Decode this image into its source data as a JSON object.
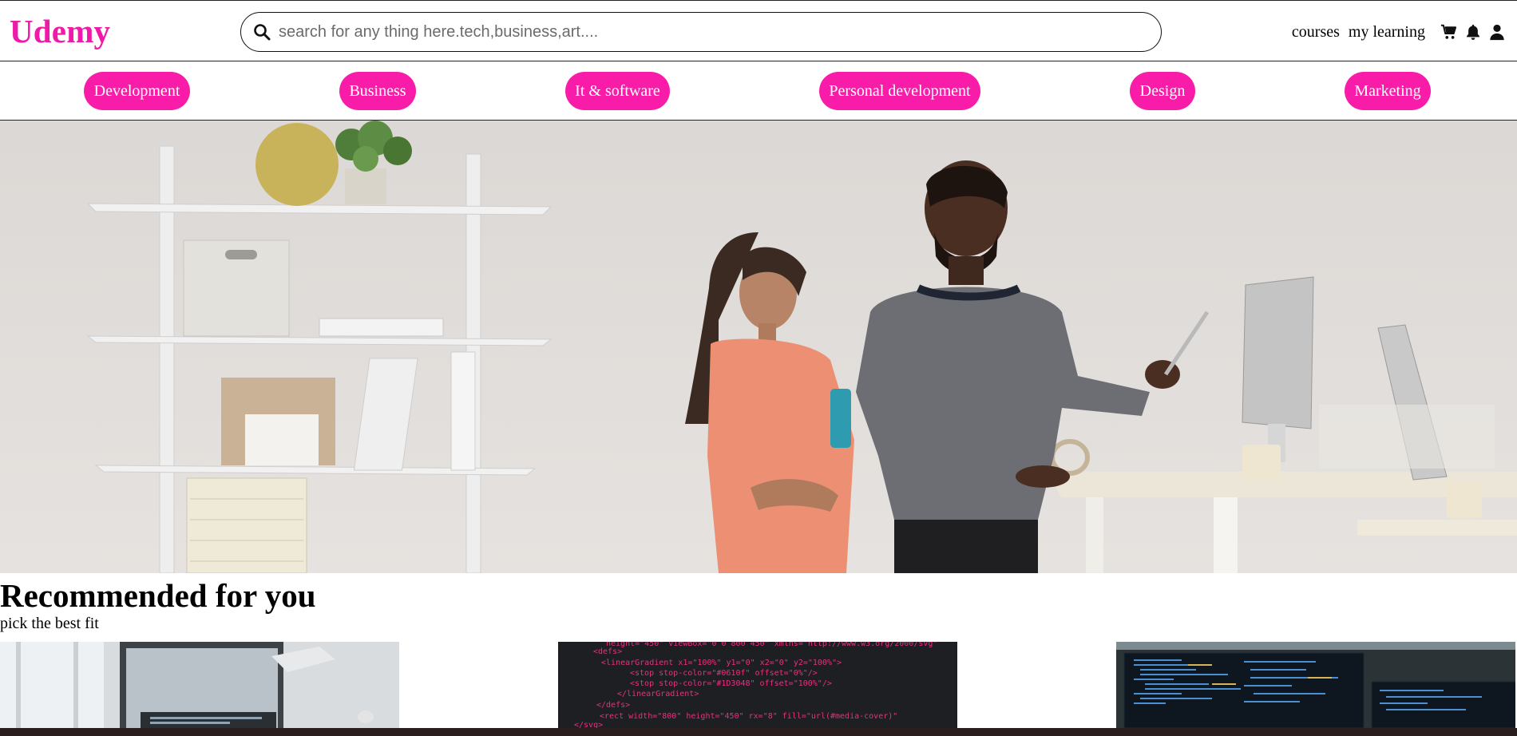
{
  "brand": {
    "name": "Udemy",
    "color": "#f01aa8"
  },
  "search": {
    "placeholder": "search for any thing here.tech,business,art...."
  },
  "nav": {
    "courses_label": "courses",
    "my_learning_label": "my learning",
    "icons": [
      "cart-icon",
      "bell-icon",
      "user-icon"
    ]
  },
  "categories": [
    {
      "label": "Development"
    },
    {
      "label": "Business"
    },
    {
      "label": "It & software"
    },
    {
      "label": "Personal development"
    },
    {
      "label": "Design"
    },
    {
      "label": "Marketing"
    }
  ],
  "accent_color": "#f81ca9",
  "recommended": {
    "title": "Recommended for you",
    "subtitle": "pick the best fit"
  },
  "code_card": {
    "lines": [
      "<defs>",
      "  <linearGradient x1=\"100%\" y1=\"0\" x2=\"0\" y2=\"100%\">",
      "    <stop stop-color=\"#0610f\" offset=\"0%\"/>",
      "    <stop stop-color=\"#1D3048\" offset=\"100%\"/>",
      "  </linearGradient>",
      "</defs>",
      "<rect width=\"800\" height=\"450\" rx=\"8\" fill=\"url(#media-cover)\"",
      "</svg>"
    ]
  }
}
